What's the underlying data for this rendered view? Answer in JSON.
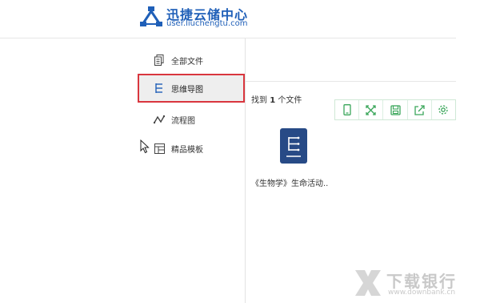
{
  "header": {
    "title": "迅捷云储中心",
    "url": "user.liuchengtu.com"
  },
  "sidebar": {
    "items": [
      {
        "label": "全部文件",
        "icon": "files-icon"
      },
      {
        "label": "思维导图",
        "icon": "mindmap-icon",
        "active": true
      },
      {
        "label": "流程图",
        "icon": "flowchart-icon"
      },
      {
        "label": "精品模板",
        "icon": "template-icon"
      }
    ]
  },
  "results": {
    "prefix": "找到",
    "count": "1",
    "suffix": "个文件"
  },
  "toolbar": {
    "buttons": [
      "mobile-icon",
      "expand-icon",
      "save-icon",
      "share-icon",
      "settings-icon"
    ]
  },
  "files": [
    {
      "name": "《生物学》生命活动..",
      "type": "mindmap"
    }
  ],
  "watermark": {
    "text": "下载银行",
    "url": "www.downbank.cn"
  },
  "colors": {
    "brand": "#1f5fb8",
    "active_border": "#d9363e",
    "toolbar_icon": "#3aa65a",
    "file_card": "#274a86"
  }
}
